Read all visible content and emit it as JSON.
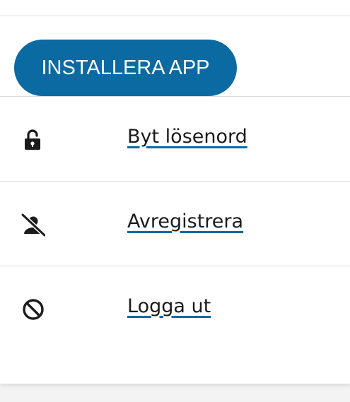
{
  "install_button": {
    "label": "INSTALLERA APP"
  },
  "menu": {
    "items": [
      {
        "label": "Byt lösenord",
        "icon": "unlocked-padlock-icon"
      },
      {
        "label": "Avregistrera",
        "icon": "user-slash-icon"
      },
      {
        "label": "Logga ut",
        "icon": "no-entry-icon"
      }
    ]
  },
  "colors": {
    "accent": "#0a6aa1",
    "text": "#1b1b1b",
    "divider": "#dcdcdc"
  }
}
